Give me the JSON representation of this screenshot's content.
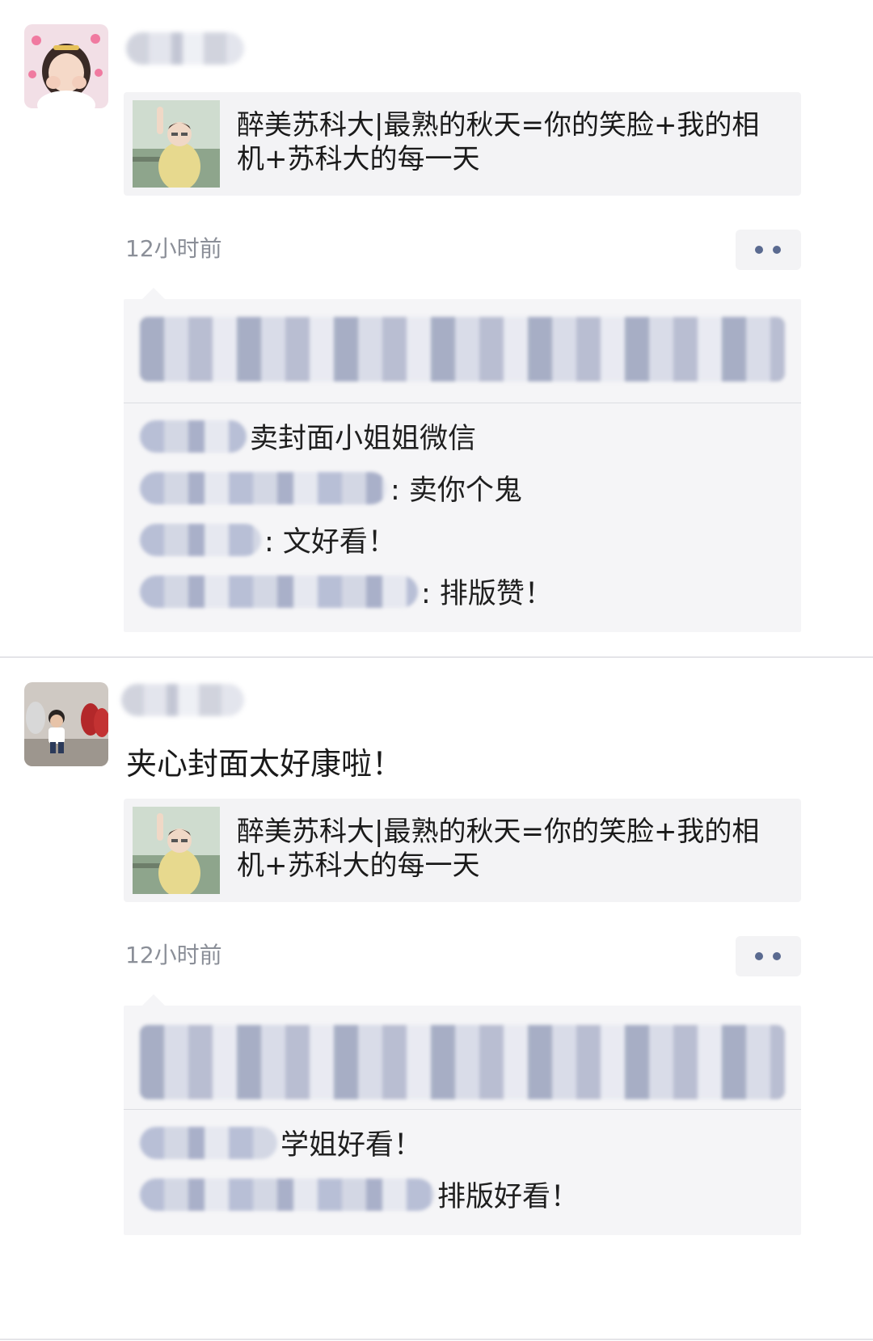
{
  "posts": [
    {
      "text": "",
      "link": {
        "title": "醉美苏科大|最熟的秋天=你的笑脸+我的相机+苏科大的每一天"
      },
      "time": "12小时前",
      "comments": [
        {
          "text": "卖封面小姐姐微信"
        },
        {
          "text": ": 卖你个鬼"
        },
        {
          "text": ": 文好看！"
        },
        {
          "text": ": 排版赞！"
        }
      ]
    },
    {
      "text": "夹心封面太好康啦！",
      "link": {
        "title": "醉美苏科大|最熟的秋天=你的笑脸+我的相机+苏科大的每一天"
      },
      "time": "12小时前",
      "comments": [
        {
          "text": "学姐好看！"
        },
        {
          "text": "排版好看！"
        }
      ]
    }
  ],
  "icons": {
    "more": "more-dots-icon"
  },
  "colors": {
    "accent": "#5a6a90",
    "card_bg": "#f3f3f5",
    "time": "#8b8f98"
  }
}
